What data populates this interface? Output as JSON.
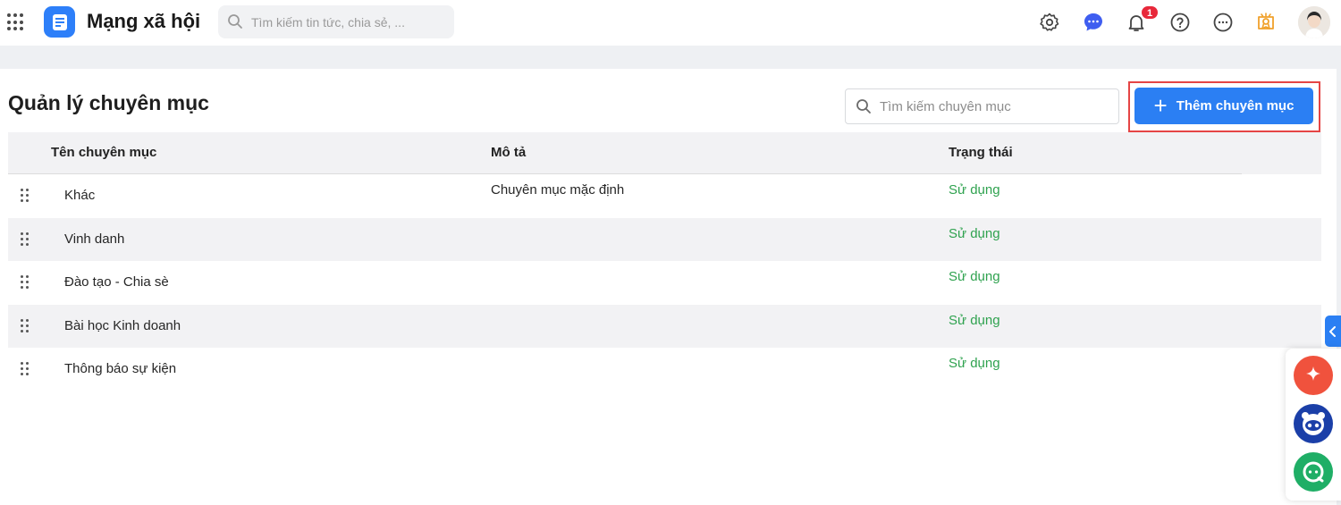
{
  "app": {
    "title": "Mạng xã hội",
    "search_placeholder": "Tìm kiếm tin tức, chia sẻ, ...",
    "notification_count": "1",
    "icons": [
      "apps-grid-icon",
      "document-icon",
      "settings-icon",
      "chat-icon",
      "bell-icon",
      "help-icon",
      "more-icon",
      "award-icon",
      "avatar"
    ]
  },
  "page": {
    "title": "Quản lý chuyên mục",
    "search_placeholder": "Tìm kiếm chuyên mục",
    "add_button_label": "Thêm chuyên mục"
  },
  "table": {
    "columns": [
      "Tên chuyên mục",
      "Mô tả",
      "Trạng thái"
    ],
    "rows": [
      {
        "name": "Khác",
        "description": "Chuyên mục mặc định",
        "status": "Sử dụng"
      },
      {
        "name": "Vinh danh",
        "description": "",
        "status": "Sử dụng"
      },
      {
        "name": "Đào tạo - Chia sè",
        "description": "",
        "status": "Sử dụng"
      },
      {
        "name": "Bài học Kinh doanh",
        "description": "",
        "status": "Sử dụng"
      },
      {
        "name": "Thông báo sự kiện",
        "description": "",
        "status": "Sử dụng"
      }
    ]
  },
  "colors": {
    "accent": "#2b7ff3",
    "status_active": "#2fa24f",
    "highlight_frame": "#e54545"
  }
}
